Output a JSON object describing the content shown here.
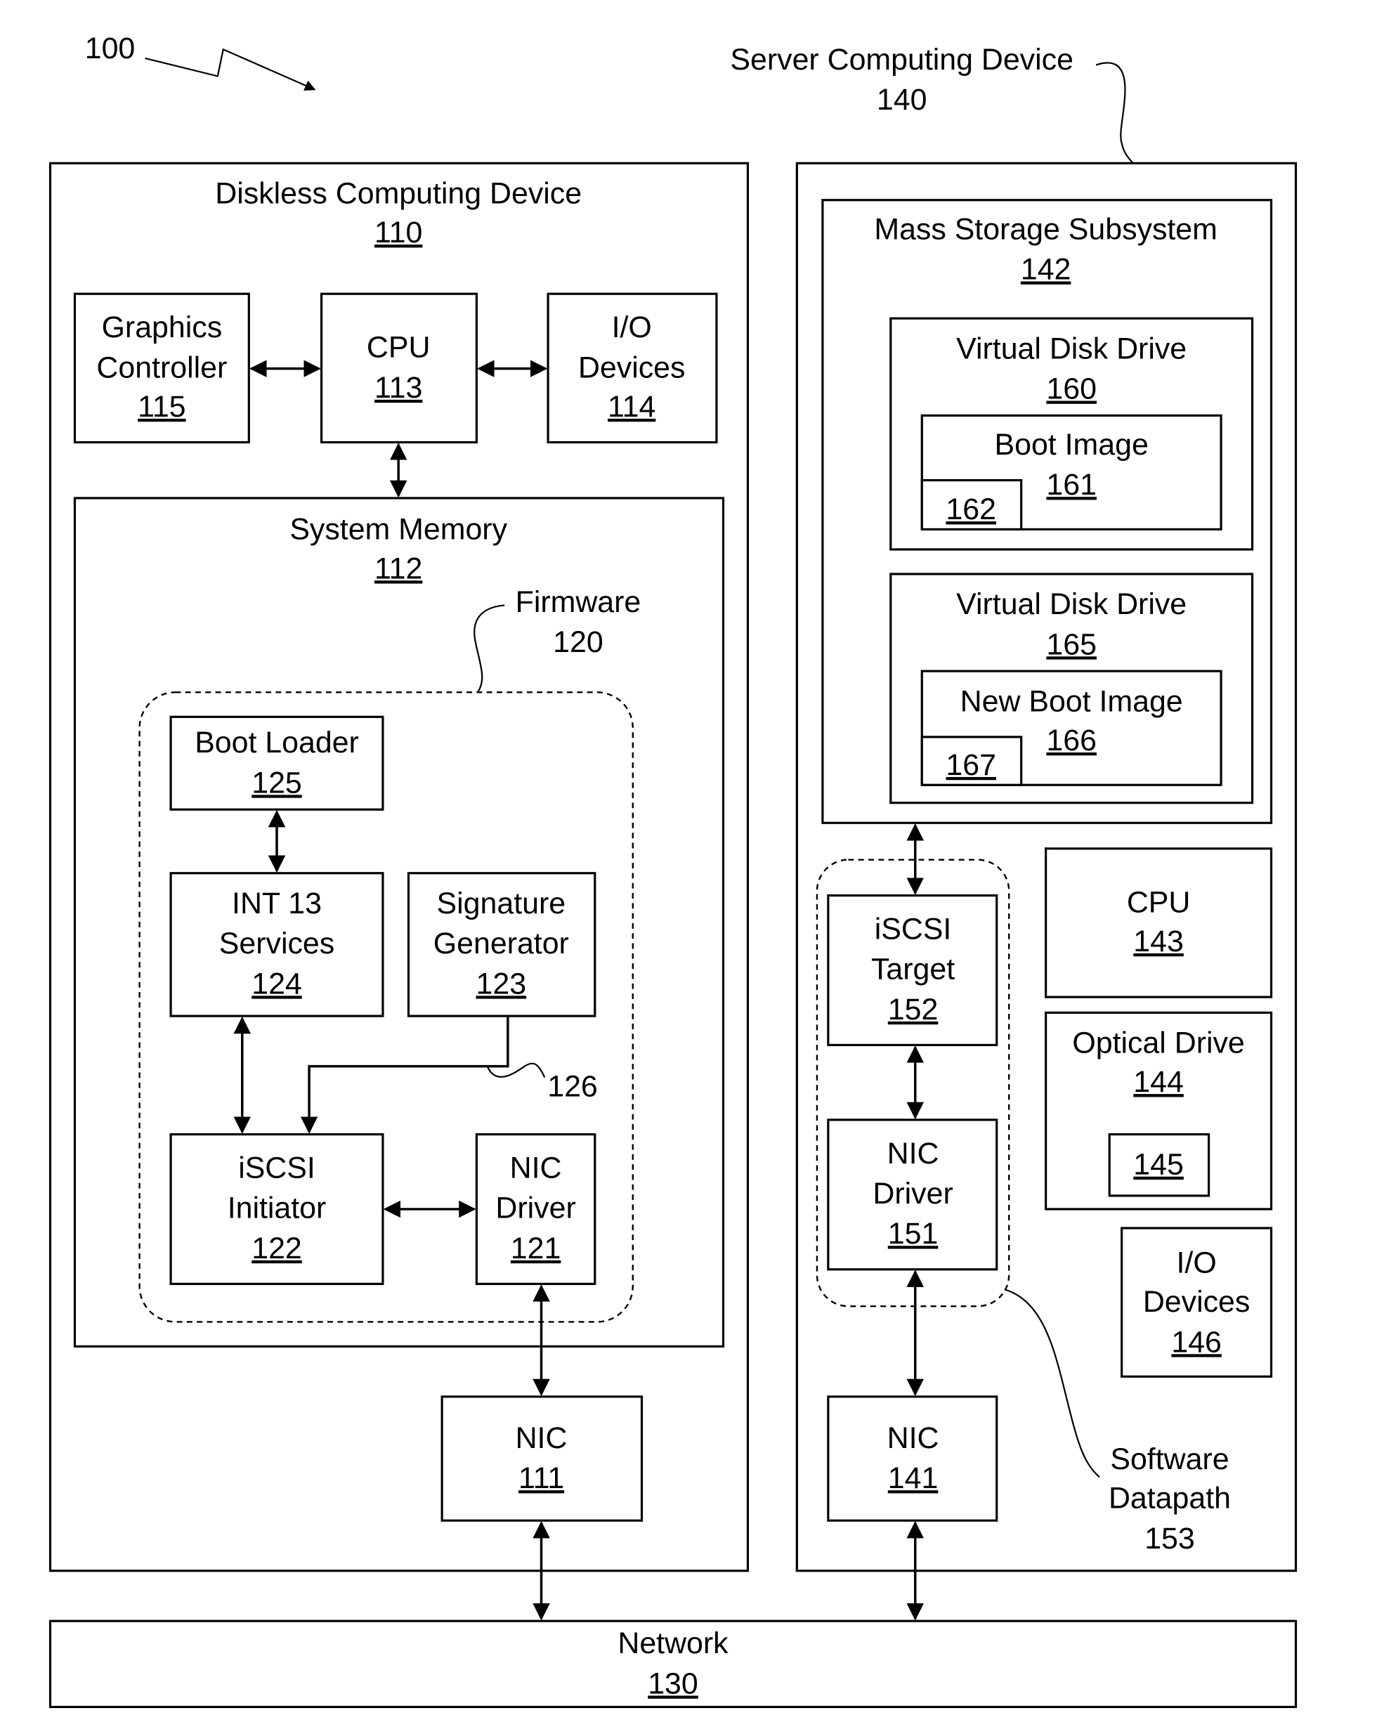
{
  "figure_ref": "100",
  "server_label": {
    "title": "Server Computing Device",
    "ref": "140"
  },
  "diskless": {
    "title": "Diskless Computing Device",
    "ref": "110",
    "graphics": {
      "l1": "Graphics",
      "l2": "Controller",
      "ref": "115"
    },
    "cpu": {
      "l1": "CPU",
      "ref": "113"
    },
    "io": {
      "l1": "I/O",
      "l2": "Devices",
      "ref": "114"
    },
    "memory": {
      "title": "System Memory",
      "ref": "112"
    },
    "firmware": {
      "title": "Firmware",
      "ref": "120"
    },
    "boot_loader": {
      "l1": "Boot Loader",
      "ref": "125"
    },
    "int13": {
      "l1": "INT 13",
      "l2": "Services",
      "ref": "124"
    },
    "sig_gen": {
      "l1": "Signature",
      "l2": "Generator",
      "ref": "123"
    },
    "path_ref": "126",
    "iscsi_init": {
      "l1": "iSCSI",
      "l2": "Initiator",
      "ref": "122"
    },
    "nic_driver": {
      "l1": "NIC",
      "l2": "Driver",
      "ref": "121"
    },
    "nic": {
      "l1": "NIC",
      "ref": "111"
    }
  },
  "server": {
    "mass_storage": {
      "title": "Mass Storage Subsystem",
      "ref": "142"
    },
    "vdd1": {
      "title": "Virtual Disk Drive",
      "ref": "160"
    },
    "boot_image": {
      "title": "Boot Image",
      "ref": "161",
      "sub_ref": "162"
    },
    "vdd2": {
      "title": "Virtual Disk Drive",
      "ref": "165"
    },
    "new_boot_image": {
      "title": "New Boot Image",
      "ref": "166",
      "sub_ref": "167"
    },
    "iscsi_target": {
      "l1": "iSCSI",
      "l2": "Target",
      "ref": "152"
    },
    "nic_driver": {
      "l1": "NIC",
      "l2": "Driver",
      "ref": "151"
    },
    "nic": {
      "l1": "NIC",
      "ref": "141"
    },
    "cpu": {
      "l1": "CPU",
      "ref": "143"
    },
    "optical": {
      "l1": "Optical Drive",
      "ref": "144",
      "sub_ref": "145"
    },
    "io": {
      "l1": "I/O",
      "l2": "Devices",
      "ref": "146"
    },
    "datapath": {
      "l1": "Software",
      "l2": "Datapath",
      "ref": "153"
    }
  },
  "network": {
    "title": "Network",
    "ref": "130"
  }
}
